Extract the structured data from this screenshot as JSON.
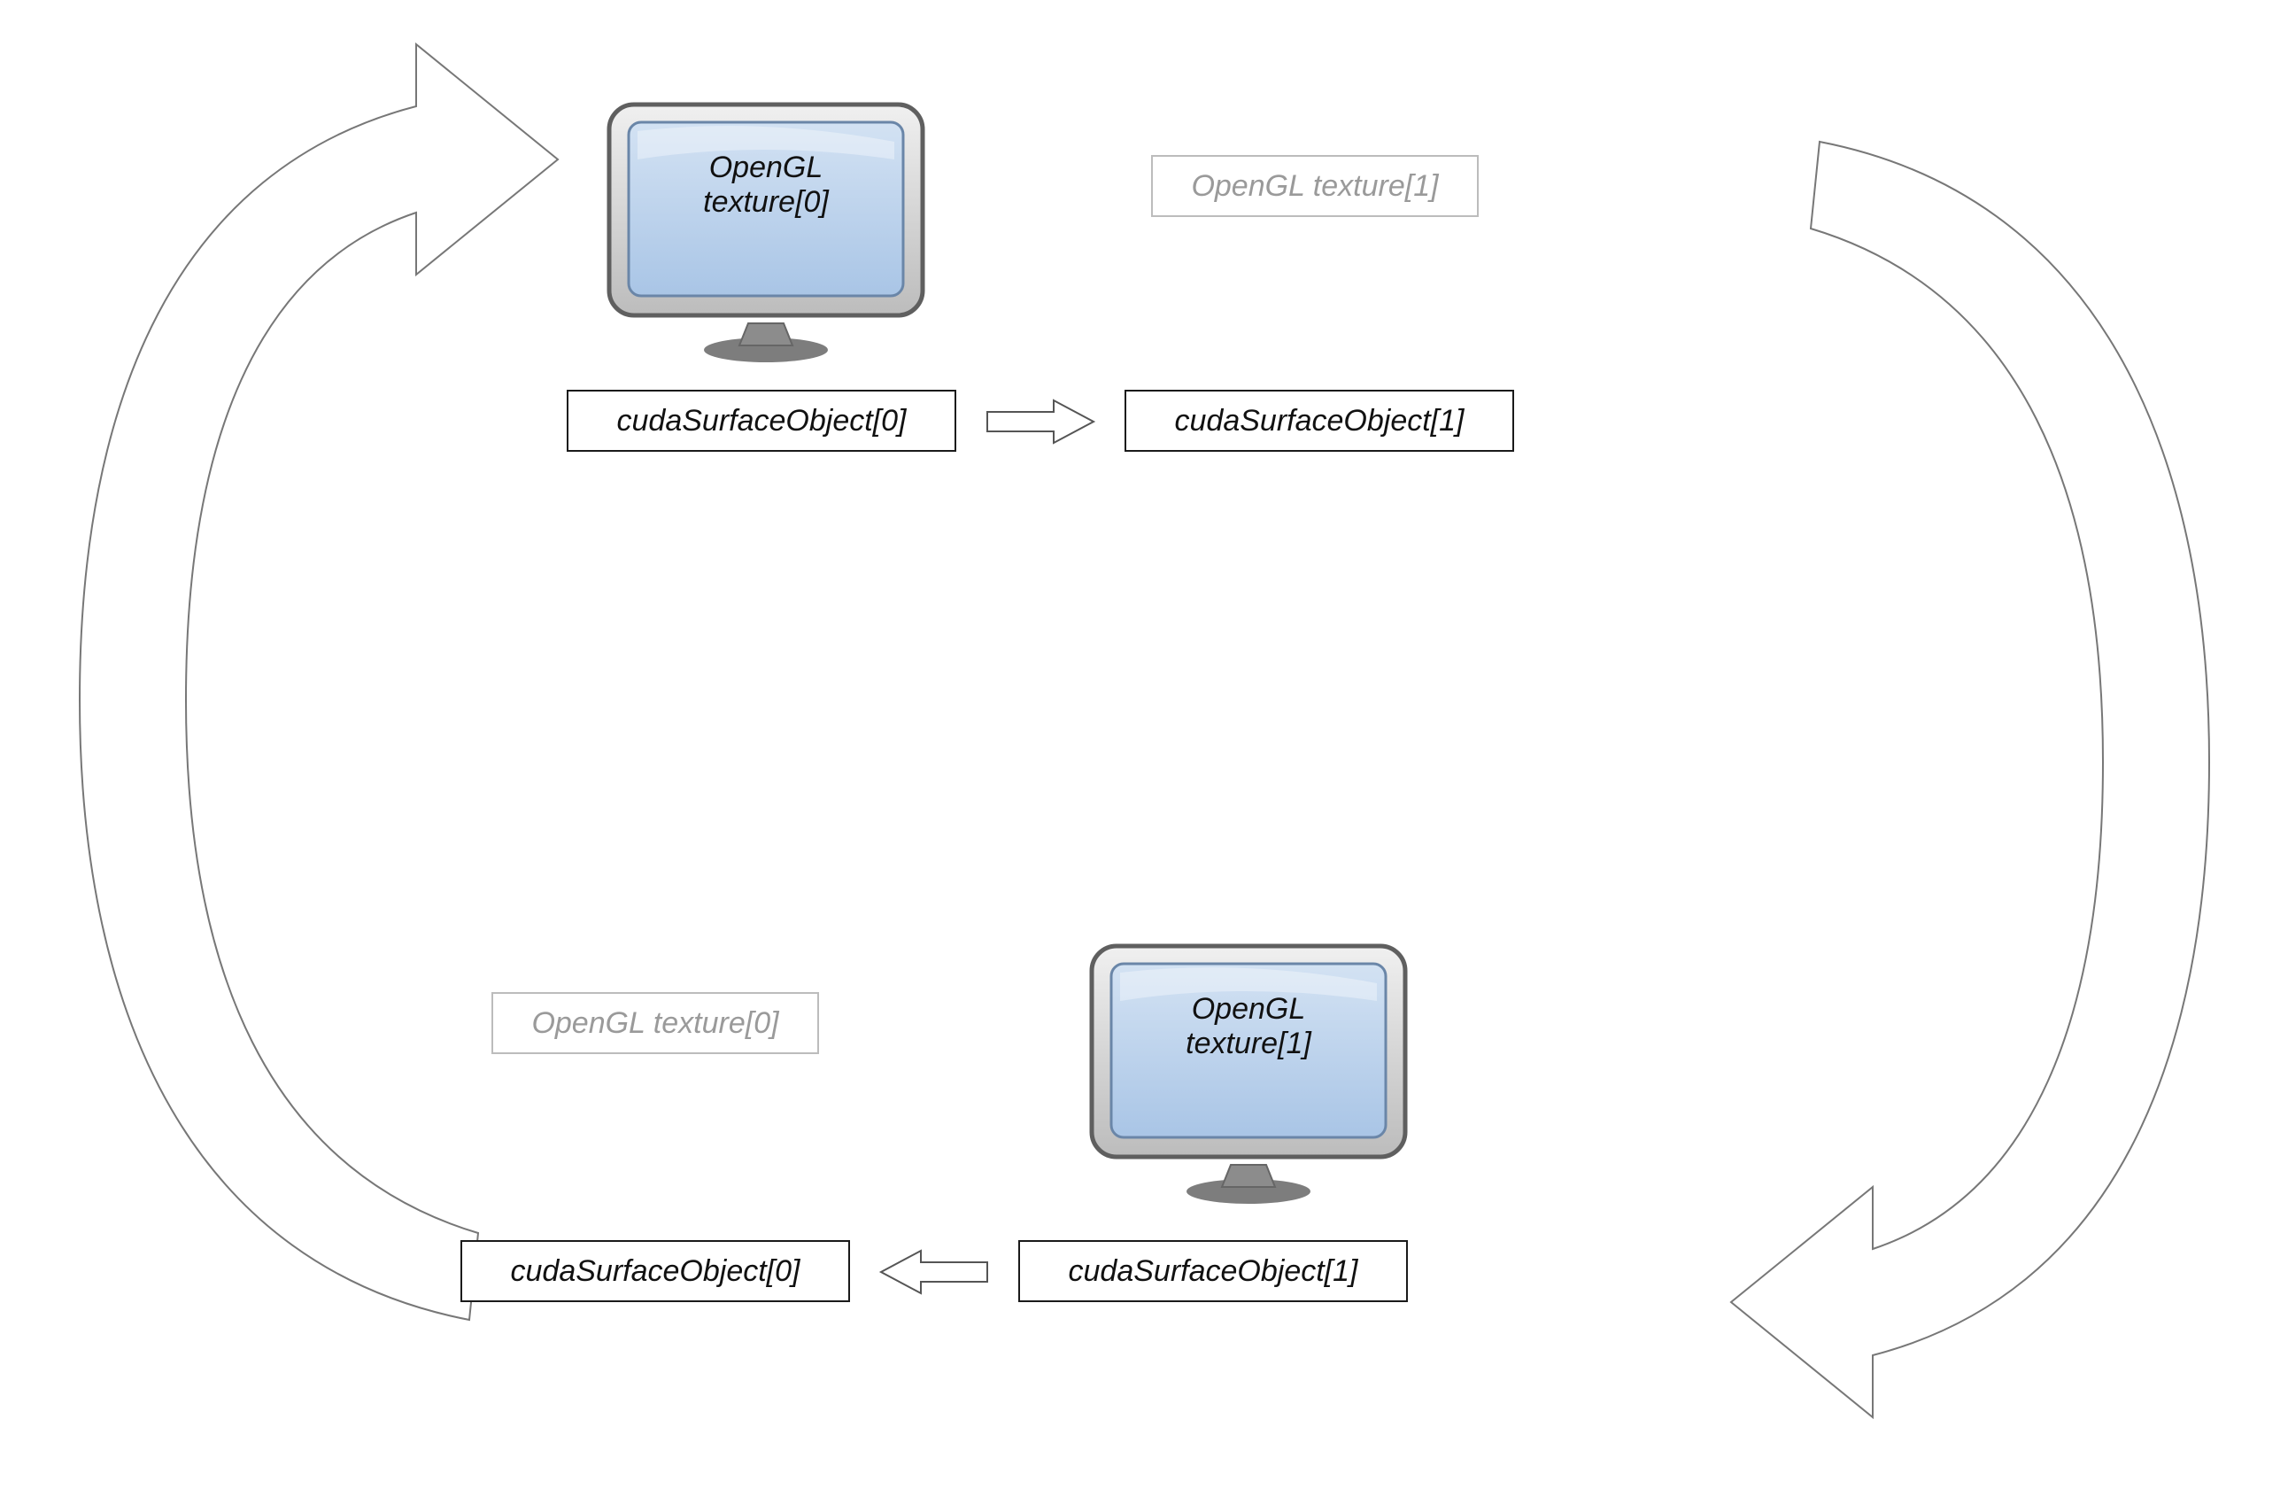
{
  "top": {
    "monitor_label_line1": "OpenGL",
    "monitor_label_line2": "texture[0]",
    "faded_label": "OpenGL texture[1]",
    "left_box": "cudaSurfaceObject[0]",
    "right_box": "cudaSurfaceObject[1]"
  },
  "bottom": {
    "faded_label": "OpenGL texture[0]",
    "monitor_label_line1": "OpenGL",
    "monitor_label_line2": "texture[1]",
    "left_box": "cudaSurfaceObject[0]",
    "right_box": "cudaSurfaceObject[1]"
  }
}
